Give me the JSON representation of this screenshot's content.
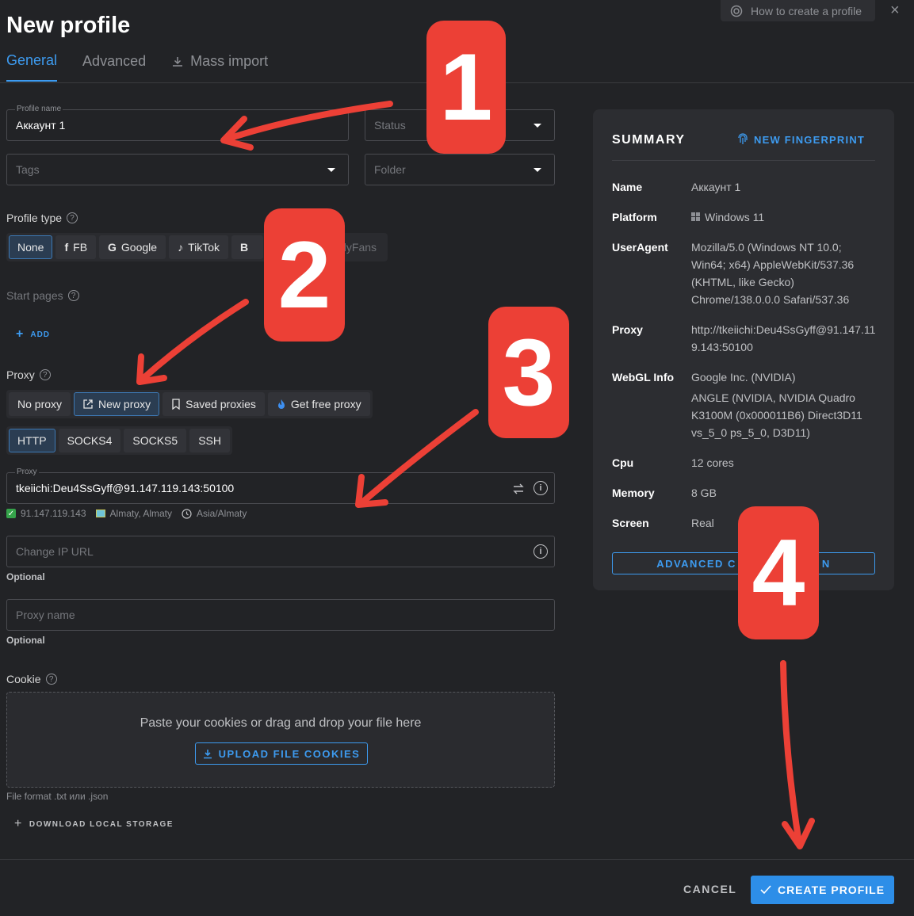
{
  "header": {
    "title": "New profile",
    "help_label": "How to create a profile",
    "close_symbol": "×"
  },
  "tabs": [
    {
      "label": "General",
      "active": true
    },
    {
      "label": "Advanced",
      "active": false
    },
    {
      "label": "Mass import",
      "active": false
    }
  ],
  "form": {
    "profile_name": {
      "label": "Profile name",
      "value": "Аккаунт 1"
    },
    "status": {
      "placeholder": "Status"
    },
    "tags": {
      "placeholder": "Tags"
    },
    "folder": {
      "placeholder": "Folder"
    },
    "profile_type": {
      "label": "Profile type",
      "options": [
        "None",
        "FB",
        "Google",
        "TikTok",
        "B",
        "lyFans"
      ],
      "selected": "None"
    },
    "start_pages": {
      "label": "Start pages",
      "add_label": "ADD"
    },
    "proxy": {
      "label": "Proxy",
      "modes": [
        "No proxy",
        "New proxy",
        "Saved proxies",
        "Get free proxy"
      ],
      "selected_mode": "New proxy",
      "protocols": [
        "HTTP",
        "SOCKS4",
        "SOCKS5",
        "SSH"
      ],
      "selected_protocol": "HTTP",
      "field_label": "Proxy",
      "value": "tkeiichi:Deu4SsGyff@91.147.119.143:50100",
      "ip": "91.147.119.143",
      "location": "Almaty, Almaty",
      "timezone": "Asia/Almaty"
    },
    "change_ip_url": {
      "placeholder": "Change IP URL",
      "hint": "Optional"
    },
    "proxy_name": {
      "placeholder": "Proxy name",
      "hint": "Optional"
    },
    "cookie": {
      "label": "Cookie",
      "drop_text": "Paste your cookies or drag and drop your file here",
      "upload_label": "UPLOAD FILE COOKIES",
      "file_format": "File format .txt или .json"
    },
    "download_local_storage": "DOWNLOAD LOCAL STORAGE"
  },
  "summary": {
    "title": "SUMMARY",
    "new_fingerprint": "NEW FINGERPRINT",
    "rows": [
      {
        "key": "Name",
        "value": "Аккаунт 1"
      },
      {
        "key": "Platform",
        "value": "Windows 11"
      },
      {
        "key": "UserAgent",
        "value": "Mozilla/5.0 (Windows NT 10.0; Win64; x64) AppleWebKit/537.36 (KHTML, like Gecko) Chrome/138.0.0.0 Safari/537.36"
      },
      {
        "key": "Proxy",
        "value": "http://tkeiichi:Deu4SsGyff@91.147.119.143:50100"
      },
      {
        "key": "WebGL Info",
        "value": "Google Inc. (NVIDIA)"
      },
      {
        "key": "WebGL Info detail",
        "value": "ANGLE (NVIDIA, NVIDIA Quadro K3100M (0x000011B6) Direct3D11 vs_5_0 ps_5_0, D3D11)"
      },
      {
        "key": "Cpu",
        "value": "12 cores"
      },
      {
        "key": "Memory",
        "value": "8 GB"
      },
      {
        "key": "Screen",
        "value": "Real"
      }
    ],
    "advanced_label": "ADVANCED C",
    "advanced_label_tail": "N"
  },
  "footer": {
    "cancel_label": "CANCEL",
    "create_label": "CREATE PROFILE"
  },
  "annotations": [
    "1",
    "2",
    "3",
    "4"
  ],
  "colors": {
    "accent": "#3d9bf0",
    "badge": "#ec4036",
    "background": "#222326",
    "panel": "#2c2d31"
  }
}
